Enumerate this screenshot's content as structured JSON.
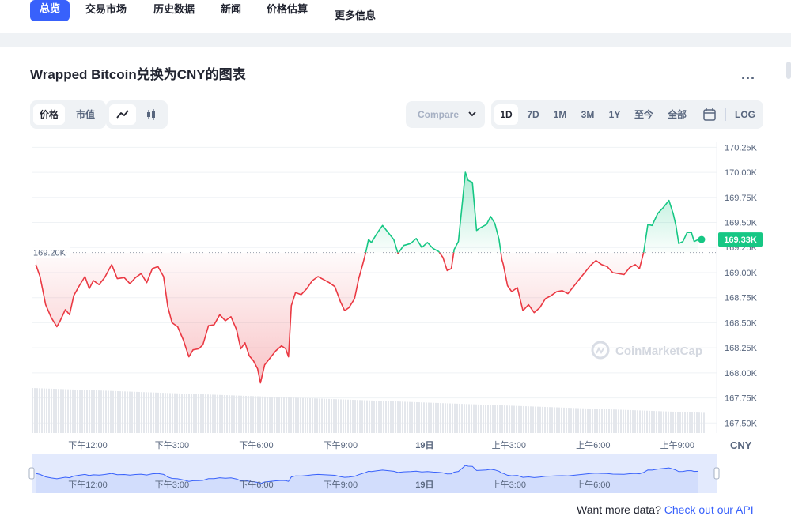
{
  "nav": {
    "items": [
      "总览",
      "交易市场",
      "历史数据",
      "新闻",
      "价格估算",
      "更多信息"
    ]
  },
  "title": "Wrapped Bitcoin兑换为CNY的图表",
  "more_label": "...",
  "toggle_price_cap": [
    "价格",
    "市值"
  ],
  "chart_style_icons": [
    "line-chart-icon",
    "candlestick-icon"
  ],
  "compare": {
    "label": "Compare",
    "icon": "chevron-down-icon"
  },
  "ranges": [
    "1D",
    "7D",
    "1M",
    "3M",
    "1Y",
    "至今",
    "全部"
  ],
  "calendar_icon": "calendar-icon",
  "log_label": "LOG",
  "watermark": "CoinMarketCap",
  "currency_label": "CNY",
  "reference_label": "169.20K",
  "current_label": "169.33K",
  "footer": {
    "text": "Want more data?",
    "link": "Check out our API"
  },
  "colors": {
    "accent": "#3861fb",
    "up": "#16c784",
    "down": "#ea3943",
    "grid": "#eff2f5"
  },
  "chart_data": {
    "type": "line",
    "currency": "CNY",
    "ylim": [
      167400,
      170300
    ],
    "yticks": [
      {
        "v": 170250,
        "label": "170.25K"
      },
      {
        "v": 170000,
        "label": "170.00K"
      },
      {
        "v": 169750,
        "label": "169.75K"
      },
      {
        "v": 169500,
        "label": "169.50K"
      },
      {
        "v": 169250,
        "label": "169.25K"
      },
      {
        "v": 169000,
        "label": "169.00K"
      },
      {
        "v": 168750,
        "label": "168.75K"
      },
      {
        "v": 168500,
        "label": "168.50K"
      },
      {
        "v": 168250,
        "label": "168.25K"
      },
      {
        "v": 168000,
        "label": "168.00K"
      },
      {
        "v": 167750,
        "label": "167.75K"
      },
      {
        "v": 167500,
        "label": "167.50K"
      }
    ],
    "xlim": [
      10.0,
      34.4
    ],
    "xticks": [
      {
        "t": 12,
        "label": "下午12:00"
      },
      {
        "t": 15,
        "label": "下午3:00"
      },
      {
        "t": 18,
        "label": "下午6:00"
      },
      {
        "t": 21,
        "label": "下午9:00"
      },
      {
        "t": 24,
        "label": "19日"
      },
      {
        "t": 27,
        "label": "上午3:00"
      },
      {
        "t": 30,
        "label": "上午6:00"
      },
      {
        "t": 33,
        "label": "上午9:00"
      }
    ],
    "nav_xticks": [
      {
        "t": 12,
        "label": "下午12:00"
      },
      {
        "t": 15,
        "label": "下午3:00"
      },
      {
        "t": 18,
        "label": "下午6:00"
      },
      {
        "t": 21,
        "label": "下午9:00"
      },
      {
        "t": 24,
        "label": "19日"
      },
      {
        "t": 27,
        "label": "上午3:00"
      },
      {
        "t": 30,
        "label": "上午6:00"
      }
    ],
    "reference": 169200,
    "current": 169330,
    "series": [
      {
        "points": [
          [
            10.15,
            169080
          ],
          [
            10.3,
            168960
          ],
          [
            10.5,
            168680
          ],
          [
            10.7,
            168550
          ],
          [
            10.9,
            168460
          ],
          [
            11.0,
            168510
          ],
          [
            11.2,
            168630
          ],
          [
            11.35,
            168580
          ],
          [
            11.5,
            168770
          ],
          [
            11.7,
            168870
          ],
          [
            11.9,
            168960
          ],
          [
            12.05,
            168840
          ],
          [
            12.2,
            168920
          ],
          [
            12.4,
            168880
          ],
          [
            12.6,
            168950
          ],
          [
            12.85,
            169080
          ],
          [
            13.05,
            168940
          ],
          [
            13.3,
            168950
          ],
          [
            13.5,
            168890
          ],
          [
            13.7,
            168950
          ],
          [
            13.9,
            168990
          ],
          [
            14.1,
            168900
          ],
          [
            14.3,
            169040
          ],
          [
            14.5,
            169060
          ],
          [
            14.7,
            168960
          ],
          [
            14.85,
            168660
          ],
          [
            15.0,
            168500
          ],
          [
            15.2,
            168460
          ],
          [
            15.4,
            168330
          ],
          [
            15.6,
            168160
          ],
          [
            15.75,
            168230
          ],
          [
            15.95,
            168240
          ],
          [
            16.1,
            168280
          ],
          [
            16.3,
            168470
          ],
          [
            16.5,
            168480
          ],
          [
            16.7,
            168580
          ],
          [
            16.9,
            168520
          ],
          [
            17.1,
            168560
          ],
          [
            17.3,
            168430
          ],
          [
            17.45,
            168240
          ],
          [
            17.6,
            168300
          ],
          [
            17.75,
            168170
          ],
          [
            17.9,
            168120
          ],
          [
            18.05,
            168040
          ],
          [
            18.15,
            167900
          ],
          [
            18.3,
            168080
          ],
          [
            18.5,
            168150
          ],
          [
            18.7,
            168220
          ],
          [
            18.9,
            168270
          ],
          [
            19.05,
            168240
          ],
          [
            19.15,
            168160
          ],
          [
            19.25,
            168670
          ],
          [
            19.4,
            168800
          ],
          [
            19.6,
            168780
          ],
          [
            19.8,
            168840
          ],
          [
            20.0,
            168920
          ],
          [
            20.2,
            168960
          ],
          [
            20.4,
            168930
          ],
          [
            20.6,
            168900
          ],
          [
            20.8,
            168860
          ],
          [
            21.0,
            168710
          ],
          [
            21.15,
            168620
          ],
          [
            21.3,
            168650
          ],
          [
            21.5,
            168740
          ],
          [
            21.65,
            168940
          ],
          [
            21.8,
            169090
          ],
          [
            21.9,
            169200
          ],
          [
            22.0,
            169330
          ],
          [
            22.1,
            169300
          ],
          [
            22.3,
            169390
          ],
          [
            22.5,
            169470
          ],
          [
            22.7,
            169400
          ],
          [
            22.9,
            169330
          ],
          [
            23.05,
            169190
          ],
          [
            23.25,
            169270
          ],
          [
            23.5,
            169290
          ],
          [
            23.7,
            169340
          ],
          [
            23.9,
            169250
          ],
          [
            24.1,
            169300
          ],
          [
            24.3,
            169240
          ],
          [
            24.5,
            169210
          ],
          [
            24.65,
            169150
          ],
          [
            24.8,
            169020
          ],
          [
            24.95,
            169040
          ],
          [
            25.05,
            169230
          ],
          [
            25.2,
            169310
          ],
          [
            25.35,
            169720
          ],
          [
            25.45,
            170000
          ],
          [
            25.55,
            169920
          ],
          [
            25.7,
            169900
          ],
          [
            25.85,
            169420
          ],
          [
            26.0,
            169450
          ],
          [
            26.2,
            169480
          ],
          [
            26.35,
            169560
          ],
          [
            26.5,
            169490
          ],
          [
            26.65,
            169330
          ],
          [
            26.75,
            169130
          ],
          [
            26.8,
            169080
          ],
          [
            26.95,
            168870
          ],
          [
            27.1,
            168810
          ],
          [
            27.3,
            168850
          ],
          [
            27.5,
            168620
          ],
          [
            27.7,
            168680
          ],
          [
            27.9,
            168600
          ],
          [
            28.1,
            168650
          ],
          [
            28.3,
            168740
          ],
          [
            28.5,
            168770
          ],
          [
            28.7,
            168810
          ],
          [
            28.9,
            168820
          ],
          [
            29.1,
            168790
          ],
          [
            29.3,
            168860
          ],
          [
            29.5,
            168930
          ],
          [
            29.7,
            169000
          ],
          [
            29.9,
            169070
          ],
          [
            30.1,
            169120
          ],
          [
            30.3,
            169080
          ],
          [
            30.5,
            169060
          ],
          [
            30.7,
            169000
          ],
          [
            30.9,
            168990
          ],
          [
            31.1,
            168980
          ],
          [
            31.3,
            169050
          ],
          [
            31.5,
            169080
          ],
          [
            31.65,
            169040
          ],
          [
            31.8,
            169200
          ],
          [
            31.95,
            169480
          ],
          [
            32.1,
            169470
          ],
          [
            32.3,
            169590
          ],
          [
            32.5,
            169650
          ],
          [
            32.7,
            169720
          ],
          [
            32.85,
            169590
          ],
          [
            32.95,
            169470
          ],
          [
            33.05,
            169290
          ],
          [
            33.2,
            169310
          ],
          [
            33.35,
            169400
          ],
          [
            33.5,
            169400
          ],
          [
            33.6,
            169310
          ],
          [
            33.75,
            169330
          ]
        ]
      }
    ]
  }
}
